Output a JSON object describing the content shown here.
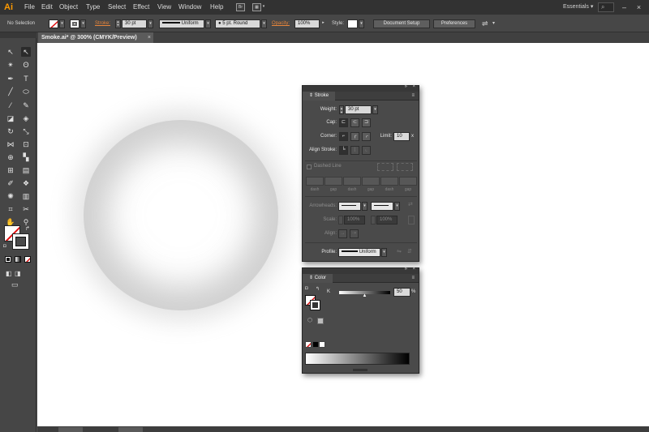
{
  "menubar": {
    "app_logo": "Ai",
    "menus": [
      "File",
      "Edit",
      "Object",
      "Type",
      "Select",
      "Effect",
      "View",
      "Window",
      "Help"
    ],
    "bridge_icon": "Br",
    "workspace": "Essentials",
    "search_icon": "search-icon",
    "minimize_label": "–",
    "close_label": "×"
  },
  "controlbar": {
    "selection_label": "No Selection",
    "stroke_label": "Stroke:",
    "stroke_weight": "30 pt",
    "profile_value": "Uniform",
    "brush_value": "5 pt. Round",
    "opacity_label": "Opacity:",
    "opacity_value": "100%",
    "style_label": "Style:",
    "document_setup": "Document Setup",
    "preferences": "Preferences"
  },
  "document_tab": {
    "title": "Smoke.ai* @ 300% (CMYK/Preview)",
    "close": "×"
  },
  "stroke_panel": {
    "title": "Stroke",
    "weight_label": "Weight:",
    "weight_value": "30 pt",
    "cap_label": "Cap:",
    "corner_label": "Corner:",
    "limit_label": "Limit:",
    "limit_value": "10",
    "limit_unit": "x",
    "align_label": "Align Stroke:",
    "dashed_label": "Dashed Line",
    "dash_labels": [
      "dash",
      "gap",
      "dash",
      "gap",
      "dash",
      "gap"
    ],
    "arrowheads_label": "Arrowheads:",
    "scale_label": "Scale:",
    "scale_value_1": "100%",
    "scale_value_2": "100%",
    "align_arrow_label": "Align:",
    "profile_label": "Profile:",
    "profile_value": "Uniform"
  },
  "color_panel": {
    "title": "Color",
    "channel_label": "K",
    "channel_value": "50",
    "channel_unit": "%",
    "k_slider_value": 0.5
  },
  "colors": {
    "accent": "#e8853a",
    "logo": "#ff9a00",
    "canvas": "#ffffff",
    "ui_dark": "#464646"
  }
}
